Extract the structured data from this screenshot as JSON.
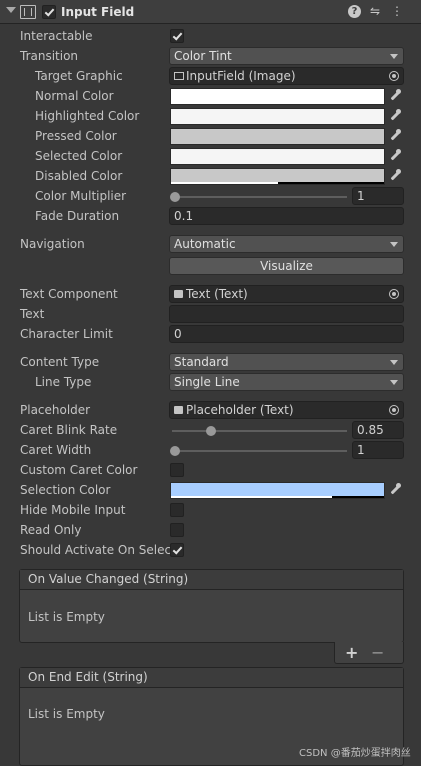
{
  "header": {
    "title": "Input Field",
    "enabled": true,
    "icons": [
      "fold-arrow-icon",
      "input-field-component-icon",
      "help-icon",
      "preset-icon",
      "more-menu-icon"
    ]
  },
  "labels": {
    "interactable": "Interactable",
    "transition": "Transition",
    "target_graphic": "Target Graphic",
    "normal_color": "Normal Color",
    "highlighted_color": "Highlighted Color",
    "pressed_color": "Pressed Color",
    "selected_color": "Selected Color",
    "disabled_color": "Disabled Color",
    "color_multiplier": "Color Multiplier",
    "fade_duration": "Fade Duration",
    "navigation": "Navigation",
    "text_component": "Text Component",
    "text": "Text",
    "character_limit": "Character Limit",
    "content_type": "Content Type",
    "line_type": "Line Type",
    "placeholder": "Placeholder",
    "caret_blink_rate": "Caret Blink Rate",
    "caret_width": "Caret Width",
    "custom_caret_color": "Custom Caret Color",
    "selection_color": "Selection Color",
    "hide_mobile_input": "Hide Mobile Input",
    "read_only": "Read Only",
    "should_activate_on_select": "Should Activate On Select"
  },
  "values": {
    "interactable": true,
    "transition": "Color Tint",
    "target_graphic": "InputField (Image)",
    "normal_color": "#FFFFFF",
    "highlighted_color": "#F5F5F5",
    "pressed_color": "#C8C8C8",
    "selected_color": "#F5F5F5",
    "disabled_color": "#C8C8C8",
    "color_multiplier": "1",
    "color_multiplier_level": 0,
    "fade_duration": "0.1",
    "navigation": "Automatic",
    "visualize_label": "Visualize",
    "text_component": "Text (Text)",
    "text": "",
    "character_limit": "0",
    "content_type": "Standard",
    "line_type": "Single Line",
    "placeholder": "Placeholder (Text)",
    "caret_blink_rate": "0.85",
    "caret_blink_rate_level": 0.21,
    "caret_width": "1",
    "caret_width_level": 0,
    "custom_caret_color": false,
    "selection_color": "#A8CEFF",
    "hide_mobile_input": false,
    "read_only": false,
    "should_activate_on_select": true
  },
  "events": [
    {
      "title": "On Value Changed (String)",
      "empty_text": "List is Empty"
    },
    {
      "title": "On End Edit (String)",
      "empty_text": "List is Empty"
    }
  ],
  "event_buttons": {
    "add": "+",
    "remove": "−"
  },
  "watermark": "CSDN @番茄炒蛋拌肉丝"
}
